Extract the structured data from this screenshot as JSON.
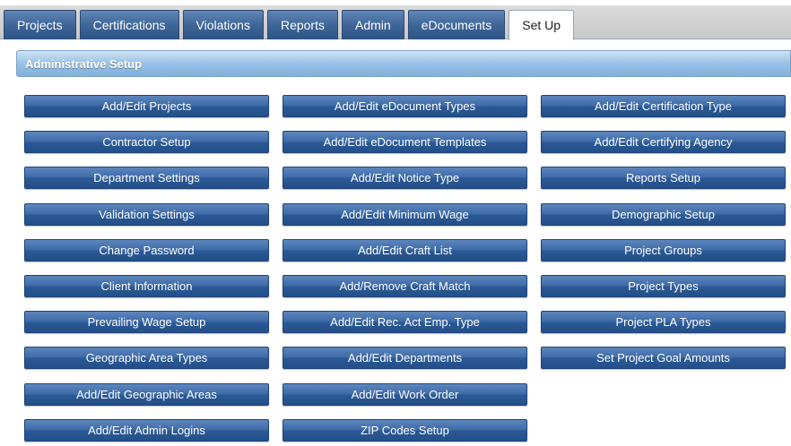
{
  "tabs": [
    {
      "label": "Projects",
      "active": false
    },
    {
      "label": "Certifications",
      "active": false
    },
    {
      "label": "Violations",
      "active": false
    },
    {
      "label": "Reports",
      "active": false
    },
    {
      "label": "Admin",
      "active": false
    },
    {
      "label": "eDocuments",
      "active": false
    },
    {
      "label": "Set Up",
      "active": true
    }
  ],
  "section": {
    "title": "Administrative Setup"
  },
  "columns": [
    [
      "Add/Edit Projects",
      "Contractor Setup",
      "Department Settings",
      "Validation Settings",
      "Change Password",
      "Client Information",
      "Prevailing Wage Setup",
      "Geographic Area Types",
      "Add/Edit Geographic Areas",
      "Add/Edit Admin Logins"
    ],
    [
      "Add/Edit eDocument Types",
      "Add/Edit eDocument Templates",
      "Add/Edit Notice Type",
      "Add/Edit Minimum Wage",
      "Add/Edit Craft List",
      "Add/Remove Craft Match",
      "Add/Edit Rec. Act Emp. Type",
      "Add/Edit Departments",
      "Add/Edit Work Order",
      "ZIP Codes Setup"
    ],
    [
      "Add/Edit Certification Type",
      "Add/Edit Certifying Agency",
      "Reports Setup",
      "Demographic Setup",
      "Project Groups",
      "Project Types",
      "Project PLA Types",
      "Set Project Goal Amounts"
    ]
  ]
}
